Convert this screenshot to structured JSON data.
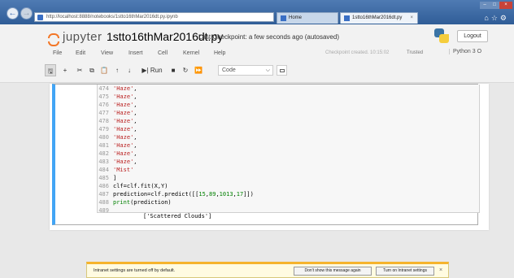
{
  "browser": {
    "url": "http://localhost:8888/notebooks/1stto16thMar2016dt.py.ipynb",
    "addr_controls": "⌕ ▾ ↻",
    "tabs": [
      {
        "label": "Home"
      },
      {
        "label": "1stto16thMar2016dt.py"
      }
    ],
    "tab_close": "×"
  },
  "header": {
    "brand": "jupyter",
    "notebook_name": "1stto16thMar2016dt.py",
    "checkpoint": "Last Checkpoint: a few seconds ago  (autosaved)",
    "logout": "Logout"
  },
  "menu": {
    "items": [
      "File",
      "Edit",
      "View",
      "Insert",
      "Cell",
      "Kernel",
      "Help"
    ]
  },
  "kernel": {
    "checkpoint_created": "Checkpoint created. 10:15:02",
    "trusted": "Trusted",
    "name": "Python 3",
    "status_icon": "O"
  },
  "toolbar": {
    "run_label": "Run",
    "cell_type": "Code",
    "icons": [
      "save-icon",
      "add-cell-icon",
      "cut-icon",
      "copy-icon",
      "paste-icon",
      "move-up-icon",
      "move-down-icon",
      "run-icon",
      "stop-icon",
      "restart-icon",
      "fast-forward-icon",
      "keyboard-icon"
    ]
  },
  "code": {
    "lines": [
      {
        "n": "474",
        "text": "'Haze',"
      },
      {
        "n": "475",
        "text": "'Haze',"
      },
      {
        "n": "476",
        "text": "'Haze',"
      },
      {
        "n": "477",
        "text": "'Haze',"
      },
      {
        "n": "478",
        "text": "'Haze',"
      },
      {
        "n": "479",
        "text": "'Haze',"
      },
      {
        "n": "480",
        "text": "'Haze',"
      },
      {
        "n": "481",
        "text": "'Haze',"
      },
      {
        "n": "482",
        "text": "'Haze',"
      },
      {
        "n": "483",
        "text": "'Haze',"
      },
      {
        "n": "484",
        "text": "'Mist'"
      },
      {
        "n": "485",
        "text": "]"
      },
      {
        "n": "486",
        "text": "clf=clf.fit(X,Y)"
      },
      {
        "n": "487",
        "text": "prediction=clf.predict([[15,89,1013,17]])"
      },
      {
        "n": "488",
        "text": "print(prediction)"
      },
      {
        "n": "489",
        "text": ""
      }
    ]
  },
  "output": {
    "text": "['Scattered Clouds']"
  },
  "notification": {
    "text": "Intranet settings are turned off by default.",
    "btn_dont_show": "Don't show this message again",
    "btn_turn_on": "Turn on Intranet settings",
    "close": "×"
  },
  "colors": {
    "cell_border_active": "#42a5f5",
    "string": "#ba2121",
    "number": "#008000"
  }
}
